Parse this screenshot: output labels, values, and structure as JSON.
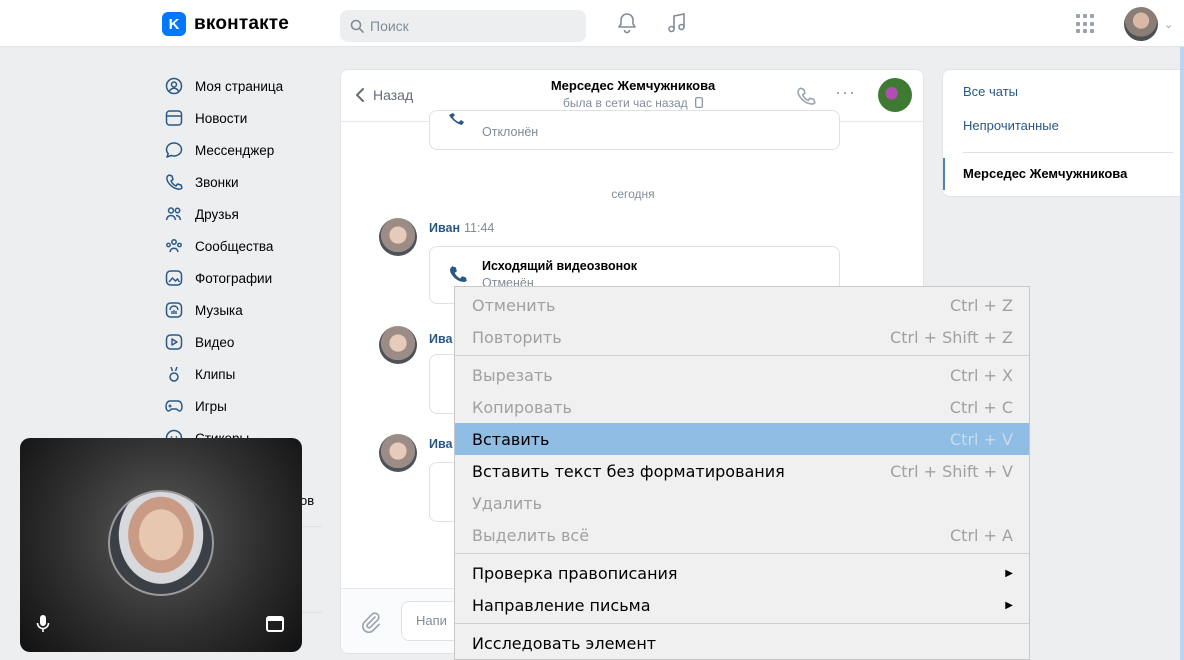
{
  "header": {
    "logo_mark": "K",
    "logo_text": "вконтакте",
    "search_placeholder": "Поиск",
    "icons": [
      "bell-icon",
      "music-icon",
      "apps-grid-icon",
      "avatar",
      "chevron-down-icon"
    ]
  },
  "nav": {
    "items": [
      {
        "label": "Моя страница",
        "icon": "user-circle-icon"
      },
      {
        "label": "Новости",
        "icon": "news-icon"
      },
      {
        "label": "Мессенджер",
        "icon": "chat-bubble-icon"
      },
      {
        "label": "Звонки",
        "icon": "phone-icon"
      },
      {
        "label": "Друзья",
        "icon": "friends-icon"
      },
      {
        "label": "Сообщества",
        "icon": "communities-icon"
      },
      {
        "label": "Фотографии",
        "icon": "photo-icon"
      },
      {
        "label": "Музыка",
        "icon": "music-app-icon"
      },
      {
        "label": "Видео",
        "icon": "video-icon"
      },
      {
        "label": "Клипы",
        "icon": "clips-icon"
      },
      {
        "label": "Игры",
        "icon": "gamepad-icon"
      },
      {
        "label": "Стикеры",
        "icon": "sticker-icon"
      }
    ],
    "partial_tail": "ов"
  },
  "chat": {
    "back_label": "Назад",
    "peer_name": "Мерседес Жемчужникова",
    "peer_status": "была в сети час назад",
    "top_call_sub": "Отклонён",
    "date_separator": "сегодня",
    "messages": [
      {
        "author": "Иван",
        "time": "11:44",
        "call_title": "Исходящий видеозвонок",
        "call_sub": "Отменён"
      },
      {
        "author": "Ива"
      },
      {
        "author": "Ива"
      }
    ],
    "input_placeholder": "Напи"
  },
  "right_panel": {
    "all_chats": "Все чаты",
    "unread": "Непрочитанные",
    "active_chat": "Мерседес Жемчужникова"
  },
  "context_menu": {
    "items": [
      {
        "label": "Отменить",
        "shortcut": "Ctrl + Z",
        "state": "disabled"
      },
      {
        "label": "Повторить",
        "shortcut": "Ctrl + Shift + Z",
        "state": "disabled"
      },
      {
        "label": "Вырезать",
        "shortcut": "Ctrl + X",
        "state": "disabled"
      },
      {
        "label": "Копировать",
        "shortcut": "Ctrl + C",
        "state": "disabled"
      },
      {
        "label": "Вставить",
        "shortcut": "Ctrl + V",
        "state": "highlighted"
      },
      {
        "label": "Вставить текст без форматирования",
        "shortcut": "Ctrl + Shift + V",
        "state": "enabled"
      },
      {
        "label": "Удалить",
        "shortcut": "",
        "state": "disabled"
      },
      {
        "label": "Выделить всё",
        "shortcut": "Ctrl + A",
        "state": "disabled"
      },
      {
        "label": "Проверка правописания",
        "shortcut": "",
        "state": "submenu"
      },
      {
        "label": "Направление письма",
        "shortcut": "",
        "state": "submenu"
      },
      {
        "label": "Исследовать элемент",
        "shortcut": "",
        "state": "enabled"
      }
    ],
    "highlight_color": "#8fbde4"
  },
  "video_call": {
    "icons": [
      "microphone-icon",
      "window-icon"
    ]
  },
  "colors": {
    "accent": "#0077ff",
    "link": "#2a5885",
    "background": "#edeef0"
  }
}
